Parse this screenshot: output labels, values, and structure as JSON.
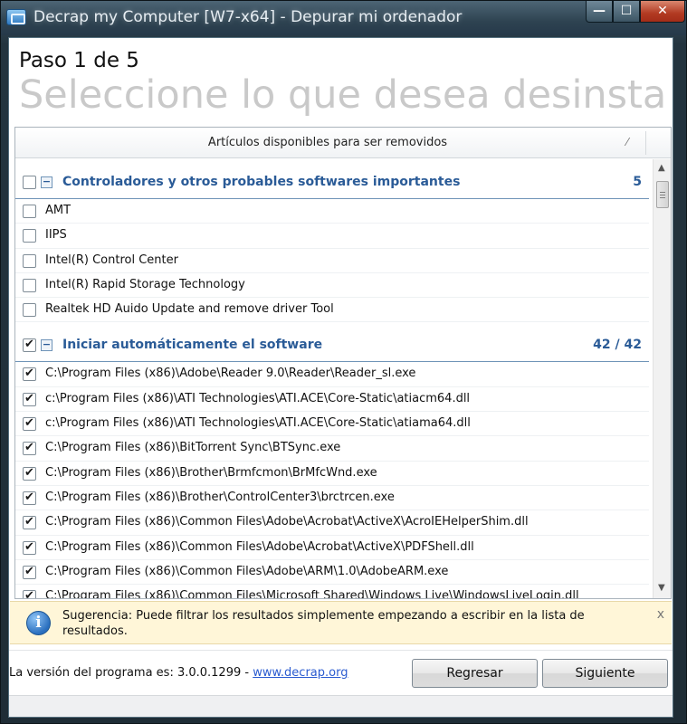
{
  "window": {
    "title": "Decrap my Computer [W7-x64] - Depurar mi ordenador",
    "minimize_label": "—",
    "maximize_label": "☐",
    "close_label": "✕"
  },
  "step": {
    "label": "Paso 1 de 5",
    "heading": "Seleccione lo que desea desinsta"
  },
  "list": {
    "header": "Artículos disponibles para ser removidos",
    "sort_glyph": "⁄",
    "groups": [
      {
        "label": "Controladores y otros probables softwares importantes",
        "count": "5",
        "checked": false,
        "items": [
          {
            "label": "AMT",
            "checked": false
          },
          {
            "label": "IIPS",
            "checked": false
          },
          {
            "label": "Intel(R) Control Center",
            "checked": false
          },
          {
            "label": "Intel(R) Rapid Storage Technology",
            "checked": false
          },
          {
            "label": "Realtek HD Auido Update and remove driver Tool",
            "checked": false
          }
        ]
      },
      {
        "label": "Iniciar automáticamente el software",
        "count": "42 / 42",
        "checked": true,
        "items": [
          {
            "label": "C:\\Program Files (x86)\\Adobe\\Reader 9.0\\Reader\\Reader_sl.exe",
            "checked": true
          },
          {
            "label": "c:\\Program Files (x86)\\ATI Technologies\\ATI.ACE\\Core-Static\\atiacm64.dll",
            "checked": true
          },
          {
            "label": "c:\\Program Files (x86)\\ATI Technologies\\ATI.ACE\\Core-Static\\atiama64.dll",
            "checked": true
          },
          {
            "label": "C:\\Program Files (x86)\\BitTorrent Sync\\BTSync.exe",
            "checked": true
          },
          {
            "label": "C:\\Program Files (x86)\\Brother\\Brmfcmon\\BrMfcWnd.exe",
            "checked": true
          },
          {
            "label": "C:\\Program Files (x86)\\Brother\\ControlCenter3\\brctrcen.exe",
            "checked": true
          },
          {
            "label": "C:\\Program Files (x86)\\Common Files\\Adobe\\Acrobat\\ActiveX\\AcroIEHelperShim.dll",
            "checked": true
          },
          {
            "label": "C:\\Program Files (x86)\\Common Files\\Adobe\\Acrobat\\ActiveX\\PDFShell.dll",
            "checked": true
          },
          {
            "label": "C:\\Program Files (x86)\\Common Files\\Adobe\\ARM\\1.0\\AdobeARM.exe",
            "checked": true
          },
          {
            "label": "C:\\Program Files (x86)\\Common Files\\Microsoft Shared\\Windows Live\\WindowsLiveLogin.dll",
            "checked": true
          }
        ]
      }
    ]
  },
  "hint": {
    "icon": "info-icon",
    "text": "Sugerencia: Puede filtrar los resultados simplemente empezando a escribir en la lista de resultados.",
    "close_label": "x"
  },
  "footer": {
    "version_text": "La versión del programa es: 3.0.0.1299 - ",
    "version_link": "www.decrap.org",
    "back_label": "Regresar",
    "next_label": "Siguiente"
  }
}
